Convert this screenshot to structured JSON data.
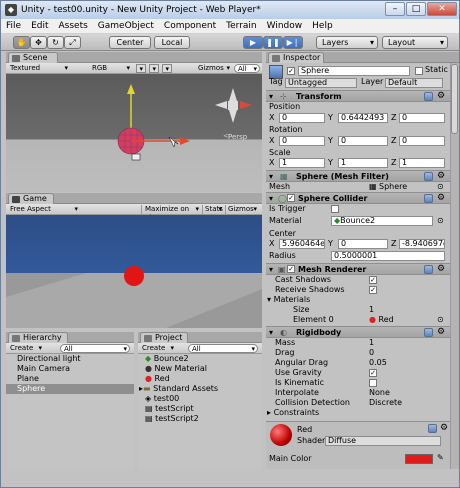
{
  "window": {
    "title": "Unity - test00.unity - New Unity Project - Web Player*",
    "app_icon": "unity-logo-icon"
  },
  "menu": [
    "File",
    "Edit",
    "Assets",
    "GameObject",
    "Component",
    "Terrain",
    "Window",
    "Help"
  ],
  "toolbar": {
    "tools": [
      "hand",
      "move",
      "rotate",
      "scale"
    ],
    "center": "Center",
    "local": "Local",
    "play": "▶",
    "pause": "❚❚",
    "step": "▶❘",
    "layers": "Layers",
    "layout": "Layout"
  },
  "scene": {
    "tab": "Scene",
    "modes": [
      "Textured",
      "RGB"
    ],
    "gizmos": "Gizmos",
    "search": "All",
    "persp": "Persp"
  },
  "game": {
    "tab": "Game",
    "aspect": "Free Aspect",
    "max": "Maximize on Play",
    "stats": "Stats",
    "gizmos": "Gizmos"
  },
  "hierarchy": {
    "tab": "Hierarchy",
    "create": "Create",
    "search": "All",
    "items": [
      "Directional light",
      "Main Camera",
      "Plane",
      "Sphere"
    ],
    "selected": 3
  },
  "project": {
    "tab": "Project",
    "create": "Create",
    "search": "All",
    "items": [
      "Bounce2",
      "New Material",
      "Red",
      "Standard Assets",
      "test00",
      "testScript",
      "testScript2"
    ]
  },
  "inspector": {
    "tab": "Inspector",
    "name": "Sphere",
    "static": "Static",
    "tag_label": "Tag",
    "tag": "Untagged",
    "layer_label": "Layer",
    "layer": "Default",
    "transform": {
      "title": "Transform",
      "position": "Position",
      "rotation": "Rotation",
      "scale": "Scale",
      "pos": [
        "0",
        "0.6442493",
        "0"
      ],
      "rot": [
        "0",
        "0",
        "0"
      ],
      "scl": [
        "1",
        "1",
        "1"
      ],
      "x": "X",
      "y": "Y",
      "z": "Z"
    },
    "meshfilter": {
      "title": "Sphere (Mesh Filter)",
      "mesh_label": "Mesh",
      "mesh": "Sphere"
    },
    "collider": {
      "title": "Sphere Collider",
      "trigger": "Is Trigger",
      "material_label": "Material",
      "material": "Bounce2",
      "center": "Center",
      "cx": "5.960464e-0",
      "cy": "0",
      "cz": "-8.940697e-",
      "radius_label": "Radius",
      "radius": "0.5000001"
    },
    "renderer": {
      "title": "Mesh Renderer",
      "cast": "Cast Shadows",
      "receive": "Receive Shadows",
      "materials": "Materials",
      "size_label": "Size",
      "size": "1",
      "element_label": "Element 0",
      "element": "Red"
    },
    "rigidbody": {
      "title": "Rigidbody",
      "mass_label": "Mass",
      "mass": "1",
      "drag_label": "Drag",
      "drag": "0",
      "adrag_label": "Angular Drag",
      "adrag": "0.05",
      "gravity": "Use Gravity",
      "kinematic": "Is Kinematic",
      "interp_label": "Interpolate",
      "interp": "None",
      "collision_label": "Collision Detection",
      "collision": "Discrete",
      "constraints": "Constraints"
    },
    "material": {
      "name": "Red",
      "shader_label": "Shader",
      "shader": "Diffuse",
      "maincolor": "Main Color",
      "color": "#e01b1b"
    }
  }
}
